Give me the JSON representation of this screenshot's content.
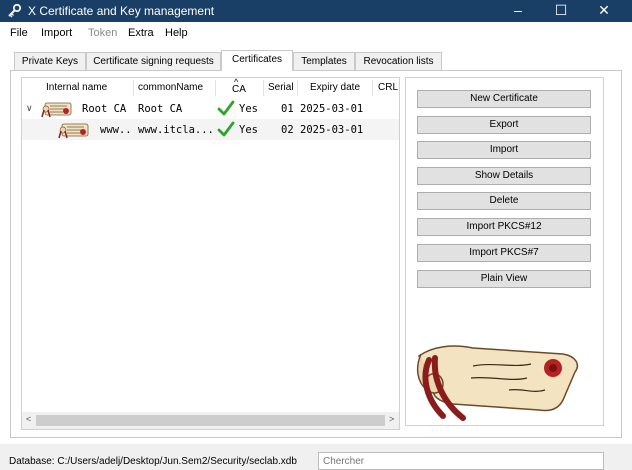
{
  "window": {
    "title": "X Certificate and Key management",
    "controls": {
      "minimize": "–",
      "maximize": "☐",
      "close": "✕"
    }
  },
  "menu": {
    "items": [
      "File",
      "Import",
      "Token",
      "Extra",
      "Help"
    ],
    "disabled": [
      "Token"
    ]
  },
  "tabs": [
    "Private Keys",
    "Certificate signing requests",
    "Certificates",
    "Templates",
    "Revocation lists"
  ],
  "active_tab": "Certificates",
  "table": {
    "columns": [
      "Internal name",
      "commonName",
      "CA",
      "Serial",
      "Expiry date",
      "CRL"
    ],
    "sort_indicator": "^",
    "rows": [
      {
        "internal_name": "Root CA",
        "common_name": "Root CA",
        "ca": "Yes",
        "serial": "01",
        "expiry": "2025-03-01",
        "expanded": true,
        "level": 0
      },
      {
        "internal_name": "www...",
        "common_name": "www.itcla...",
        "ca": "Yes",
        "serial": "02",
        "expiry": "2025-03-01",
        "level": 1
      }
    ]
  },
  "buttons": [
    "New Certificate",
    "Export",
    "Import",
    "Show Details",
    "Delete",
    "Import PKCS#12",
    "Import PKCS#7",
    "Plain View"
  ],
  "status": {
    "database": "Database: C:/Users/adelj/Desktop/Jun.Sem2/Security/seclab.xdb",
    "search_placeholder": "Chercher"
  },
  "colors": {
    "titlebar": "#1a3f66",
    "check_green": "#2ea52a",
    "scroll_red": "#8c1c1c",
    "parchment": "#f3e3c0"
  },
  "icons": {
    "app": "key-certificate-icon",
    "row": "certificate-scroll-icon",
    "ca": "check-icon",
    "expander": "chevron-down-icon",
    "logo": "scroll-seal-logo"
  }
}
